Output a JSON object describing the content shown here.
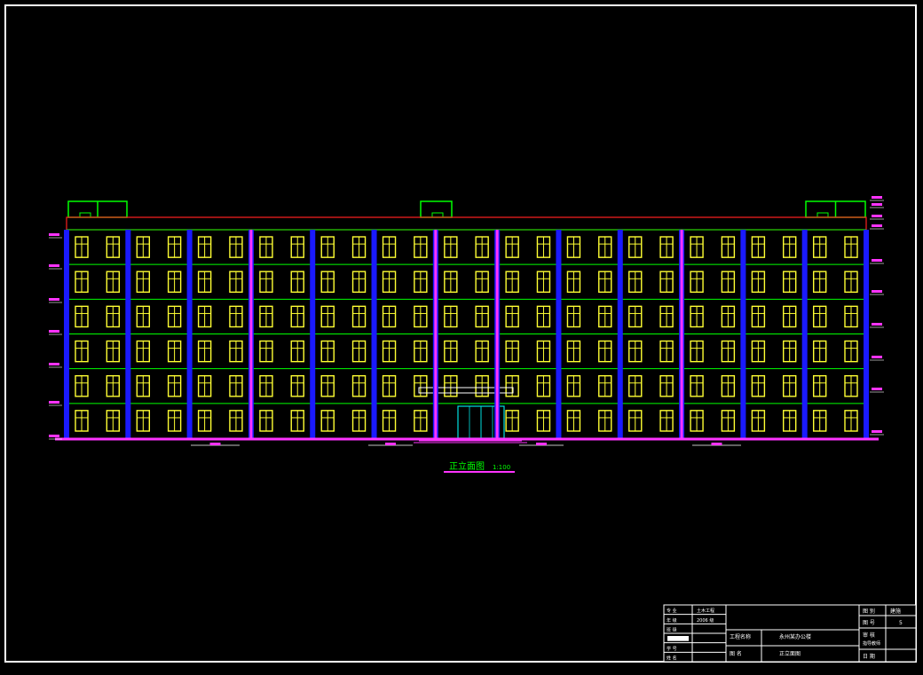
{
  "drawing": {
    "title": "正立面图",
    "scale": "1:100"
  },
  "title_block": {
    "left_rows": [
      {
        "label": "专  业",
        "value": "土木工程"
      },
      {
        "label": "年  级",
        "value": "2006  级"
      },
      {
        "label": "班  级",
        "value": ""
      },
      {
        "label": "",
        "value": ""
      },
      {
        "label": "学  号",
        "value": ""
      },
      {
        "label": "姓  名",
        "value": ""
      }
    ],
    "project_name_label": "工程名称",
    "project_name": "永州某办公楼",
    "sheet_name_label": "图  名",
    "sheet_name": "正立面图",
    "right_labels": {
      "sheet_type": "图  别",
      "sheet_type_value": "建施",
      "sheet_no": "图  号",
      "sheet_no_value": "5",
      "approval": "审  核",
      "instructor": "指导教师",
      "date": "日  期"
    }
  },
  "colors": {
    "background": "#000000",
    "frame": "#ffffff",
    "column": "#1a1aff",
    "accent": "#ff33ff",
    "window": "#ffff33",
    "floor_line": "#00ff00",
    "roof_line": "#ff2020",
    "label": "#00ff00"
  },
  "building": {
    "floors": 6,
    "bays": 13,
    "windows_per_bay": 2
  }
}
